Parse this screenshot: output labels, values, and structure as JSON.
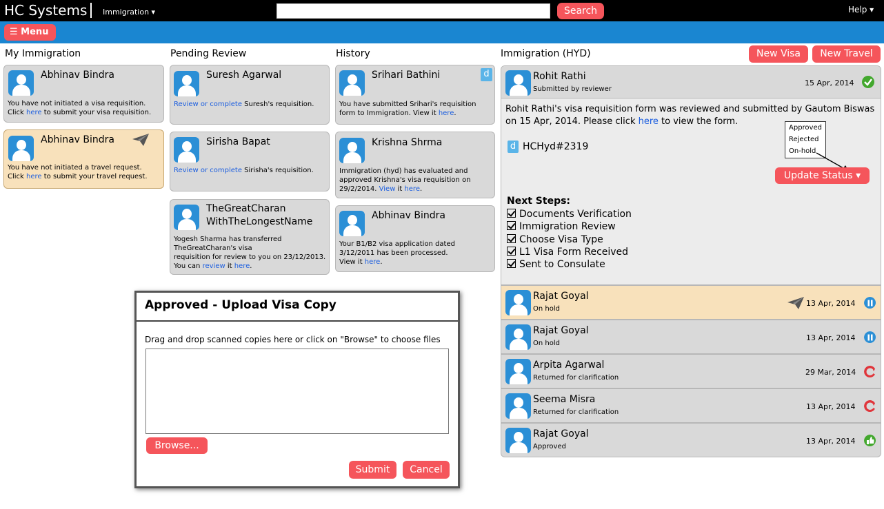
{
  "topbar": {
    "brand": "HC Systems",
    "module": "Immigration ▾",
    "search_value": "",
    "search_button": "Search",
    "help": "Help ▾"
  },
  "nav": {
    "menu_label": "☰ Menu"
  },
  "columns": {
    "my": "My Immigration",
    "pending": "Pending Review",
    "history": "History",
    "detail": "Immigration (HYD)"
  },
  "my": [
    {
      "name": "Abhinav Bindra",
      "line1": "You have not initiated a visa requisition.",
      "line2_pre": "Click ",
      "link": "here",
      "line2_post": " to submit your visa requisition."
    },
    {
      "name": "Abhinav Bindra",
      "line1": "You have not initiated a travel request.",
      "line2_pre": "Click ",
      "link": "here",
      "line2_post": " to submit your travel request."
    }
  ],
  "pending": [
    {
      "name": "Suresh Agarwal",
      "link": "Review or complete",
      "text": " Suresh's requisition."
    },
    {
      "name": "Sirisha Bapat",
      "link": "Review or complete",
      "text": " Sirisha's requisition."
    },
    {
      "name1": "TheGreatCharan",
      "name2": "WithTheLongestName",
      "l1": "Yogesh Sharma has transferred",
      "l2": "TheGreatCharan's visa",
      "l3": "requisition for review to you on 23/12/2013.",
      "l4_pre": "You can ",
      "l4_link1": "review",
      "l4_mid": " it ",
      "l4_link2": "here",
      "l4_post": "."
    }
  ],
  "history": [
    {
      "name": "Srihari Bathini",
      "l1": "You have submitted Srihari's requisition",
      "l2_pre": "form to Immigration. View it ",
      "l2_link": "here",
      "l2_post": "."
    },
    {
      "name": "Krishna Shrma",
      "l1": "Immigration (hyd) has evaluated and",
      "l2": "approved Krishna's visa requisition on",
      "l3_pre": "29/2/2014. ",
      "l3_link1": "View",
      "l3_mid": " it ",
      "l3_link2": "here",
      "l3_post": "."
    },
    {
      "name": "Abhinav Bindra",
      "l1": "Your B1/B2 visa application dated",
      "l2": "3/12/2011 has been processed.",
      "l3_pre": "View it ",
      "l3_link": "here",
      "l3_post": "."
    }
  ],
  "actions": {
    "new_visa": "New Visa",
    "new_travel": "New Travel"
  },
  "detail": {
    "name": "Rohit Rathi",
    "sub": "Submitted by reviewer",
    "date": "15 Apr, 2014",
    "desc1": "Rohit Rathi's visa requisition form was reviewed and submitted by Gautom Biswas",
    "desc2_pre": "on 15 Apr, 2014. Please click ",
    "desc2_link": "here",
    "desc2_post": " to view the form.",
    "doc_id": "HCHyd#2319",
    "status_options": [
      "Approved",
      "Rejected",
      "On-hold"
    ],
    "update_status": "Update Status ▾",
    "next_steps_title": "Next Steps:",
    "steps": [
      "Documents Verification",
      "Immigration Review",
      "Choose Visa Type",
      "L1 Visa Form Received",
      "Sent to Consulate"
    ]
  },
  "rows": [
    {
      "name": "Rajat Goyal",
      "sub": "On hold",
      "date": "13 Apr, 2014",
      "status": "pause",
      "color": "#2b8fd6"
    },
    {
      "name": "Rajat Goyal",
      "sub": "On hold",
      "date": "13 Apr, 2014",
      "status": "pause",
      "color": "#2b8fd6"
    },
    {
      "name": "Arpita Agarwal",
      "sub": "Returned for clarification",
      "date": "29 Mar, 2014",
      "status": "return",
      "color": "#e0353b"
    },
    {
      "name": "Seema Misra",
      "sub": "Returned for clarification",
      "date": "13 Apr, 2014",
      "status": "return",
      "color": "#e0353b"
    },
    {
      "name": "Rajat Goyal",
      "sub": "Approved",
      "date": "13 Apr, 2014",
      "status": "thumbs-up",
      "color": "#43a82e"
    }
  ],
  "modal": {
    "title": "Approved - Upload Visa Copy",
    "instructions": "Drag and drop scanned copies here or click on \"Browse\" to choose files",
    "browse": "Browse...",
    "submit": "Submit",
    "cancel": "Cancel"
  },
  "colors": {
    "accent_red": "#f5555b",
    "bar_blue": "#1a86d1",
    "avatar_blue": "#2b8fd6",
    "ok_green": "#43a82e"
  }
}
